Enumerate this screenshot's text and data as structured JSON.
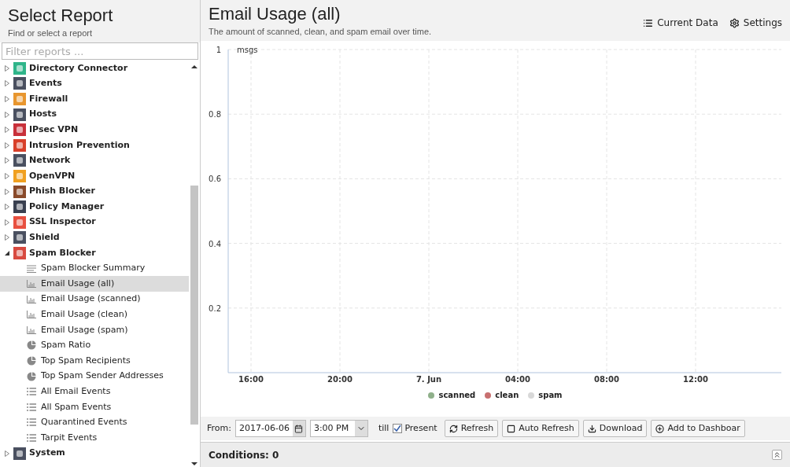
{
  "sidebar": {
    "title": "Select Report",
    "subtitle": "Find or select a report",
    "filter": {
      "placeholder": "Filter reports ..."
    },
    "tree": [
      {
        "label": "Directory Connector",
        "color": "#2fb58a",
        "expanded": false,
        "selected": false
      },
      {
        "label": "Events",
        "color": "#4a5060",
        "expanded": false,
        "selected": false
      },
      {
        "label": "Firewall",
        "color": "#e8962e",
        "expanded": false,
        "selected": false
      },
      {
        "label": "Hosts",
        "color": "#4a5060",
        "expanded": false,
        "selected": false
      },
      {
        "label": "IPsec VPN",
        "color": "#c8303a",
        "expanded": false,
        "selected": false
      },
      {
        "label": "Intrusion Prevention",
        "color": "#d8402a",
        "expanded": false,
        "selected": false
      },
      {
        "label": "Network",
        "color": "#4a5060",
        "expanded": false,
        "selected": false
      },
      {
        "label": "OpenVPN",
        "color": "#f0a020",
        "expanded": false,
        "selected": false
      },
      {
        "label": "Phish Blocker",
        "color": "#8a4a2a",
        "expanded": false,
        "selected": false
      },
      {
        "label": "Policy Manager",
        "color": "#3a4050",
        "expanded": false,
        "selected": false
      },
      {
        "label": "SSL Inspector",
        "color": "#e85040",
        "expanded": false,
        "selected": false
      },
      {
        "label": "Shield",
        "color": "#4a5060",
        "expanded": false,
        "selected": false
      },
      {
        "label": "Spam Blocker",
        "color": "#d84a40",
        "expanded": true,
        "selected": false,
        "children": [
          {
            "label": "Spam Blocker Summary",
            "kind": "summary",
            "selected": false
          },
          {
            "label": "Email Usage (all)",
            "kind": "bar",
            "selected": true
          },
          {
            "label": "Email Usage (scanned)",
            "kind": "bar",
            "selected": false
          },
          {
            "label": "Email Usage (clean)",
            "kind": "bar",
            "selected": false
          },
          {
            "label": "Email Usage (spam)",
            "kind": "bar",
            "selected": false
          },
          {
            "label": "Spam Ratio",
            "kind": "pie",
            "selected": false
          },
          {
            "label": "Top Spam Recipients",
            "kind": "pie",
            "selected": false
          },
          {
            "label": "Top Spam Sender Addresses",
            "kind": "pie",
            "selected": false
          },
          {
            "label": "All Email Events",
            "kind": "list",
            "selected": false
          },
          {
            "label": "All Spam Events",
            "kind": "list",
            "selected": false
          },
          {
            "label": "Quarantined Events",
            "kind": "list",
            "selected": false
          },
          {
            "label": "Tarpit Events",
            "kind": "list",
            "selected": false
          }
        ]
      },
      {
        "label": "System",
        "color": "#4a5060",
        "expanded": false,
        "selected": false
      }
    ]
  },
  "report": {
    "title": "Email Usage (all)",
    "description": "The amount of scanned, clean, and spam email over time.",
    "actions": [
      "Current Data",
      "Settings"
    ],
    "chart_data": {
      "type": "line",
      "grid": true,
      "ylabel": "msgs",
      "x": [
        "16:00",
        "20:00",
        "7. Jun",
        "04:00",
        "08:00",
        "12:00"
      ],
      "yticks": [
        0.2,
        0.4,
        0.6,
        0.8,
        1
      ],
      "ylim": [
        0,
        1
      ],
      "series": [
        {
          "name": "scanned",
          "color": "#8fb08a",
          "values": [
            null,
            null,
            null,
            null,
            null,
            null
          ]
        },
        {
          "name": "clean",
          "color": "#c87070",
          "values": [
            null,
            null,
            null,
            null,
            null,
            null
          ]
        },
        {
          "name": "spam",
          "color": "#d8d8d8",
          "values": [
            null,
            null,
            null,
            null,
            null,
            null
          ]
        }
      ]
    }
  },
  "toolbar": {
    "from_label": "From:",
    "date": "2017-06-06",
    "time": "3:00 PM",
    "till_label": "till",
    "present": {
      "label": "Present",
      "checked": true
    },
    "buttons": [
      "Refresh",
      "Auto Refresh",
      "Download",
      "Add to Dashboar"
    ]
  },
  "conditions": {
    "label": "Conditions: 0"
  }
}
